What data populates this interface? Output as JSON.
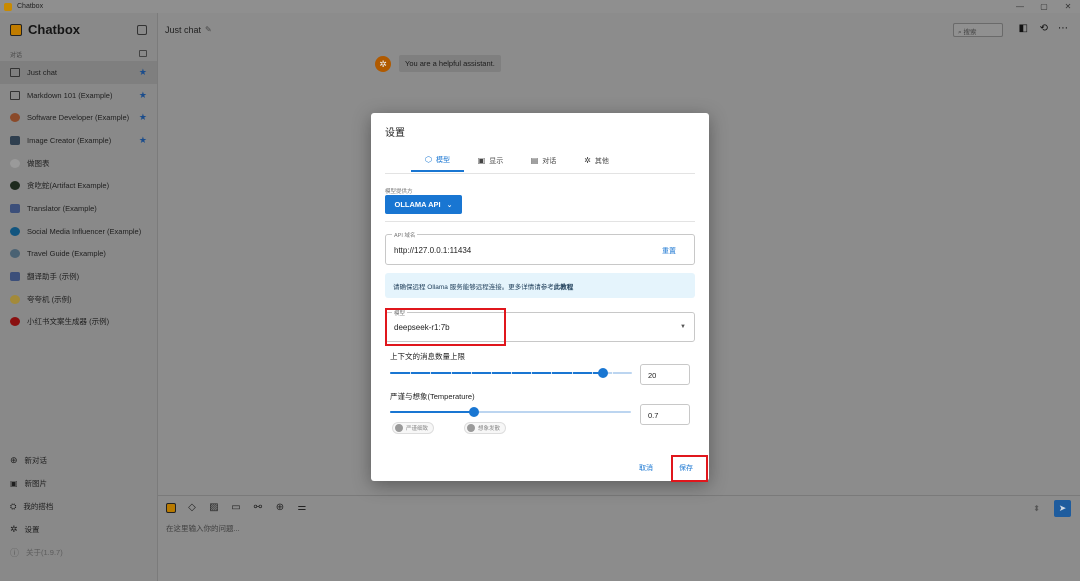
{
  "window": {
    "title": "Chatbox",
    "controls": [
      "—",
      "▢",
      "✕"
    ]
  },
  "sidebar": {
    "app_name": "Chatbox",
    "section_label": "对话",
    "items": [
      {
        "label": "Just chat",
        "starred": true,
        "active": true,
        "icon": "chat-bubble-icon"
      },
      {
        "label": "Markdown 101 (Example)",
        "starred": true,
        "icon": "chat-bubble-icon"
      },
      {
        "label": "Software Developer (Example)",
        "starred": true,
        "icon": "developer-avatar-icon"
      },
      {
        "label": "Image Creator (Example)",
        "starred": true,
        "icon": "image-avatar-icon"
      },
      {
        "label": "做图表",
        "starred": false,
        "icon": "chart-avatar-icon"
      },
      {
        "label": "贪吃蛇(Artifact Example)",
        "starred": false,
        "icon": "snake-avatar-icon"
      },
      {
        "label": "Translator (Example)",
        "starred": false,
        "icon": "translator-avatar-icon"
      },
      {
        "label": "Social Media Influencer (Example)",
        "starred": false,
        "icon": "twitter-avatar-icon"
      },
      {
        "label": "Travel Guide (Example)",
        "starred": false,
        "icon": "travel-avatar-icon"
      },
      {
        "label": "翻译助手 (示例)",
        "starred": false,
        "icon": "translator-avatar-icon"
      },
      {
        "label": "夸夸机 (示例)",
        "starred": false,
        "icon": "praise-avatar-icon"
      },
      {
        "label": "小红书文案生成器 (示例)",
        "starred": false,
        "icon": "xiaohongshu-avatar-icon"
      }
    ],
    "bottom": {
      "new_chat": "新对话",
      "new_image": "新图片",
      "my_partners": "我的搭档",
      "settings": "设置",
      "about": "关于(1.9.7)"
    }
  },
  "header": {
    "chat_title": "Just chat",
    "search_placeholder": "搜索"
  },
  "messages": [
    {
      "role": "system",
      "text": "You are a helpful assistant."
    }
  ],
  "input": {
    "placeholder": "在这里输入你的问题..."
  },
  "dialog": {
    "title": "设置",
    "tabs": [
      {
        "label": "模型",
        "icon": "cube-icon",
        "active": true
      },
      {
        "label": "显示",
        "icon": "display-icon",
        "active": false
      },
      {
        "label": "对话",
        "icon": "chat-icon",
        "active": false
      },
      {
        "label": "其他",
        "icon": "gear-icon",
        "active": false
      }
    ],
    "provider_label": "模型提供方",
    "provider_value": "OLLAMA API",
    "api_host_label": "API 域名",
    "api_host_value": "http://127.0.0.1:11434",
    "reset_label": "重置",
    "info_text": "请确保远程 Ollama 服务能够远程连接。更多详情请参考",
    "info_link": "此教程",
    "model_label": "模型",
    "model_value": "deepseek-r1:7b",
    "context_label": "上下文的消息数量上限",
    "context_value": "20",
    "context_fraction": 0.88,
    "temperature_label": "严谨与想象(Temperature)",
    "temperature_value": "0.7",
    "temperature_fraction": 0.35,
    "chip_strict": "严谨细致",
    "chip_creative": "想象发散",
    "cancel_label": "取消",
    "save_label": "保存"
  },
  "colors": {
    "accent": "#1976d2",
    "highlight_box": "#e0161c",
    "info_bg": "#e5f4fc"
  }
}
